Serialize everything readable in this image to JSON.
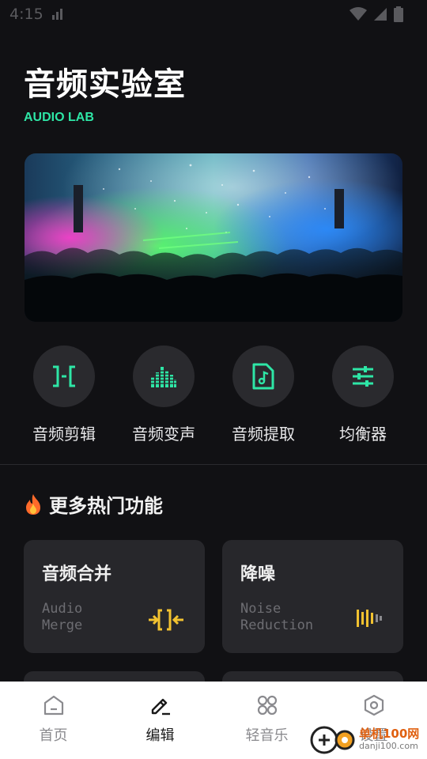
{
  "status_bar": {
    "time": "4:15"
  },
  "header": {
    "title": "音频实验室",
    "subtitle": "AUDIO LAB"
  },
  "banner": {
    "alt": "concert-crowd-image"
  },
  "tools": [
    {
      "label": "音频剪辑",
      "icon": "audio-trim-icon"
    },
    {
      "label": "音频变声",
      "icon": "equalizer-bars-icon"
    },
    {
      "label": "音频提取",
      "icon": "music-file-icon"
    },
    {
      "label": "均衡器",
      "icon": "sliders-icon"
    }
  ],
  "section": {
    "icon": "fire-icon",
    "title": "更多热门功能"
  },
  "cards": [
    {
      "title": "音频合并",
      "subtitle": "Audio\nMerge",
      "icon": "merge-icon"
    },
    {
      "title": "降噪",
      "subtitle": "Noise\nReduction",
      "icon": "noise-bars-icon"
    }
  ],
  "tabbar": [
    {
      "label": "首页",
      "icon": "home-icon",
      "active": false
    },
    {
      "label": "编辑",
      "icon": "edit-icon",
      "active": true
    },
    {
      "label": "轻音乐",
      "icon": "grid-icon",
      "active": false
    },
    {
      "label": "设置",
      "icon": "settings-icon",
      "active": false
    }
  ],
  "watermark": {
    "brand": "单机100网",
    "url": "danji100.com"
  },
  "colors": {
    "accent": "#2ee6a6",
    "background": "#111114",
    "card": "#27272b",
    "merge_icon": "#f2c230"
  }
}
